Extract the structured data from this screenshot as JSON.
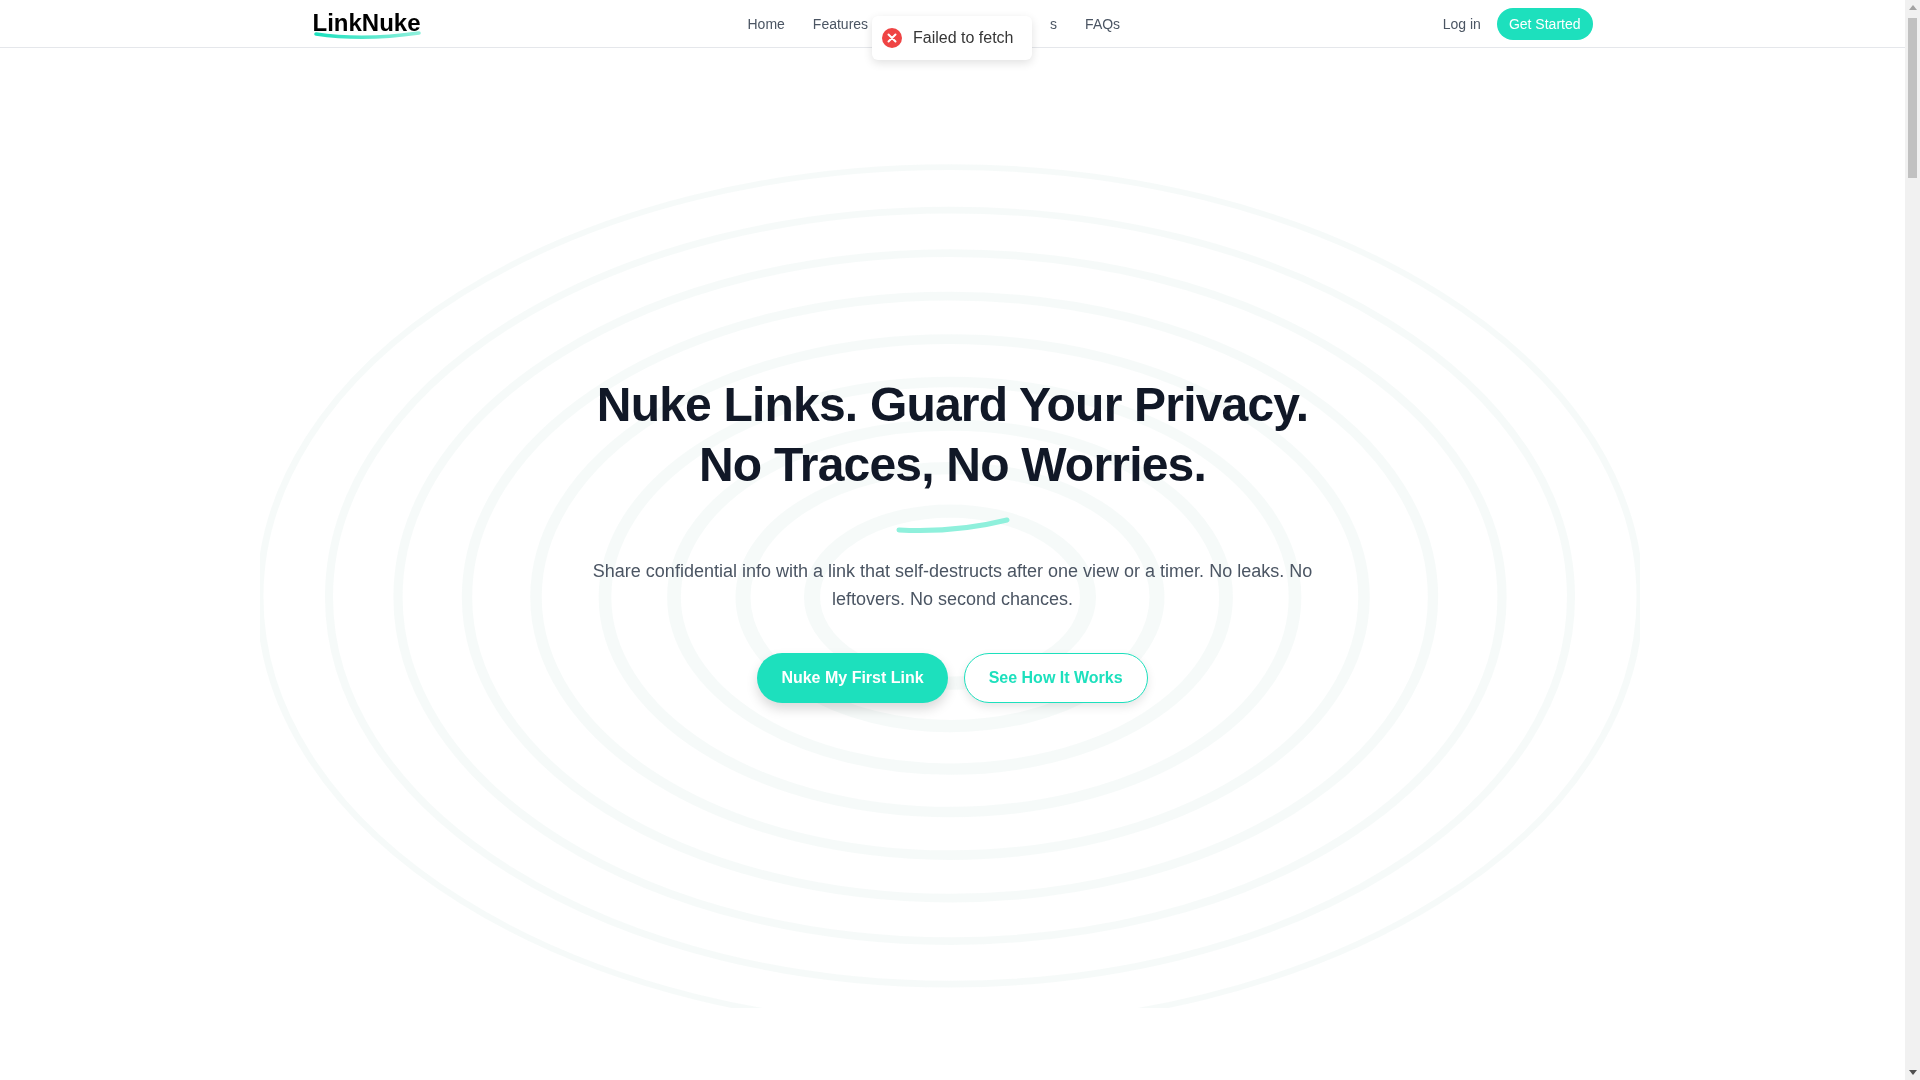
{
  "header": {
    "logo": "LinkNuke",
    "nav": [
      {
        "label": "Home",
        "kind": "link"
      },
      {
        "label": "Features",
        "kind": "link"
      },
      {
        "label": "s",
        "kind": "partial"
      },
      {
        "label": "FAQs",
        "kind": "link"
      }
    ],
    "login": "Log in",
    "cta": "Get Started"
  },
  "toast": {
    "kind": "error",
    "message": "Failed to fetch"
  },
  "hero": {
    "title_lines": [
      "Nuke Links. Guard Your Privacy.",
      "No Traces, No Worries."
    ],
    "subtitle": "Share confidential info with a link that self-destructs after one view or a timer. No leaks. No leftovers. No second chances.",
    "buttons": [
      {
        "label": "Nuke My First Link",
        "kind": "primary"
      },
      {
        "label": "See How It Works",
        "kind": "outline"
      }
    ]
  }
}
